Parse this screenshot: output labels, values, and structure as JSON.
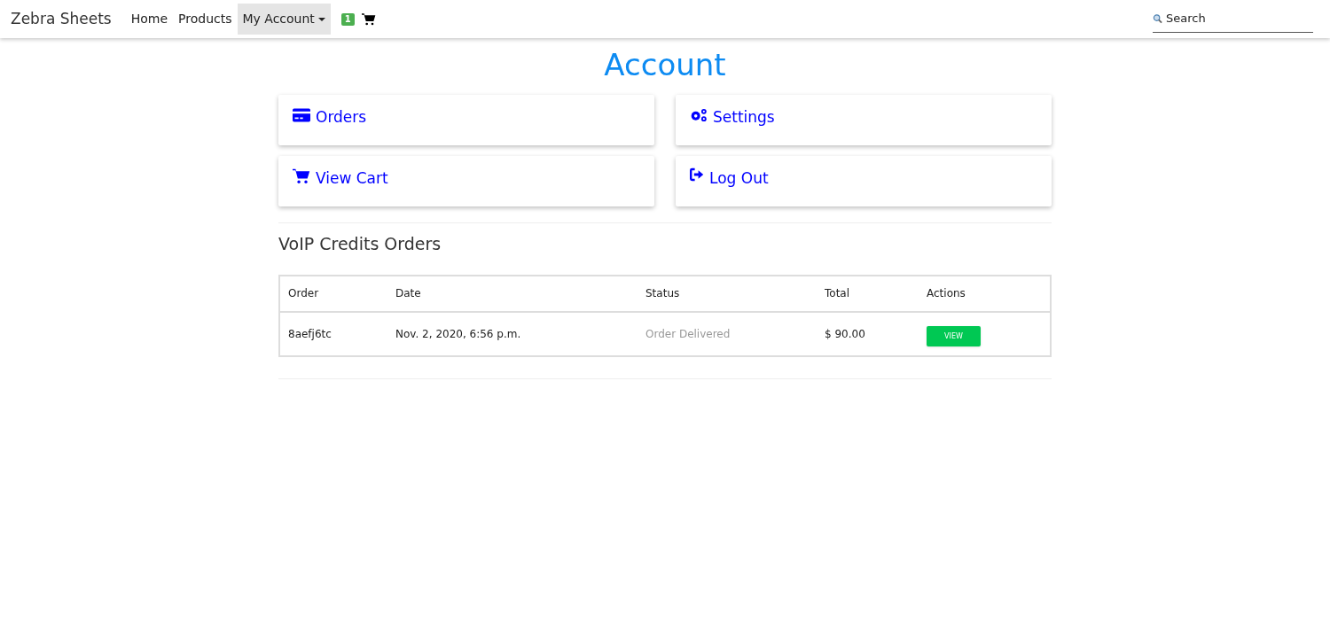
{
  "navbar": {
    "brand": "Zebra Sheets",
    "links": [
      {
        "label": "Home",
        "selected": false,
        "dropdown": false
      },
      {
        "label": "Products",
        "selected": false,
        "dropdown": false
      },
      {
        "label": "My Account",
        "selected": true,
        "dropdown": true
      }
    ],
    "cart_count": "1",
    "search": {
      "placeholder": "Search"
    }
  },
  "page_title": "Account",
  "cards": [
    {
      "kind": "orders",
      "label": "Orders"
    },
    {
      "kind": "settings",
      "label": "Settings"
    },
    {
      "kind": "cart",
      "label": "View Cart"
    },
    {
      "kind": "logout",
      "label": "Log Out"
    }
  ],
  "section_title": "VoIP Credits Orders",
  "table": {
    "columns": [
      "Order",
      "Date",
      "Status",
      "Total",
      "Actions"
    ],
    "rows": [
      {
        "order": "8aefj6tc",
        "date": "Nov. 2, 2020, 6:56 p.m.",
        "status": "Order Delivered",
        "total": "$ 90.00",
        "action": "VIEW"
      }
    ]
  }
}
